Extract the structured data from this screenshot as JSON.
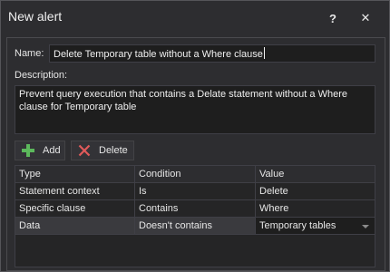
{
  "window": {
    "title": "New alert",
    "help_label": "?",
    "close_label": "✕"
  },
  "form": {
    "name_label": "Name:",
    "name_value": "Delete Temporary table without a Where clause",
    "description_label": "Description:",
    "description_value": "Prevent query execution that contains a Delate statement without a Where clause for Temporary table"
  },
  "toolbar": {
    "add_label": "Add",
    "delete_label": "Delete"
  },
  "grid": {
    "columns": [
      "Type",
      "Condition",
      "Value"
    ],
    "rows": [
      {
        "type": "Statement context",
        "condition": "Is",
        "value": "Delete"
      },
      {
        "type": "Specific clause",
        "condition": "Contains",
        "value": "Where"
      },
      {
        "type": "Data",
        "condition": "Doesn't contains",
        "value": "Temporary tables"
      }
    ]
  },
  "colors": {
    "add_icon": "#5cb85c",
    "delete_icon": "#e05a5a"
  }
}
